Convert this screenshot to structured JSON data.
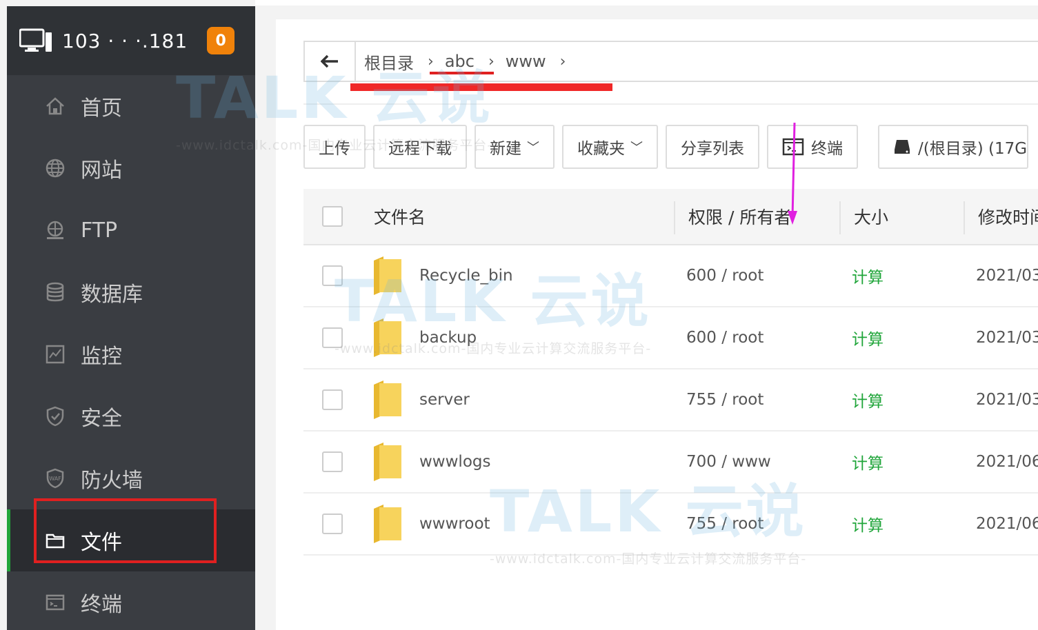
{
  "sidebar": {
    "host_ip": "103 · ·  ·.181",
    "badge": "0",
    "items": [
      {
        "label": "首页",
        "icon": "home-icon"
      },
      {
        "label": "网站",
        "icon": "globe-icon"
      },
      {
        "label": "FTP",
        "icon": "ftp-icon"
      },
      {
        "label": "数据库",
        "icon": "database-icon"
      },
      {
        "label": "监控",
        "icon": "monitor-chart-icon"
      },
      {
        "label": "安全",
        "icon": "shield-check-icon"
      },
      {
        "label": "防火墙",
        "icon": "waf-shield-icon"
      },
      {
        "label": "文件",
        "icon": "folder-icon"
      },
      {
        "label": "终端",
        "icon": "terminal-icon"
      }
    ],
    "active_item": "文件",
    "waf_icon_text": "WAF"
  },
  "breadcrumb": {
    "items": [
      "根目录",
      "abc",
      "www"
    ],
    "separator": "›"
  },
  "toolbar": {
    "upload": "上传",
    "remote_download": "远程下载",
    "new": "新建",
    "favorites": "收藏夹",
    "share_list": "分享列表",
    "terminal": "终端",
    "disk": "/(根目录) (17G"
  },
  "table": {
    "headers": {
      "name": "文件名",
      "perm": "权限 / 所有者",
      "size": "大小",
      "time": "修改时间"
    },
    "rows": [
      {
        "name": "Recycle_bin",
        "perm": "600 / root",
        "size": "计算",
        "time": "2021/03"
      },
      {
        "name": "backup",
        "perm": "600 / root",
        "size": "计算",
        "time": "2021/03"
      },
      {
        "name": "server",
        "perm": "755 / root",
        "size": "计算",
        "time": "2021/03"
      },
      {
        "name": "wwwlogs",
        "perm": "700 / www",
        "size": "计算",
        "time": "2021/06"
      },
      {
        "name": "wwwroot",
        "perm": "755 / root",
        "size": "计算",
        "time": "2021/06"
      }
    ]
  },
  "watermark": {
    "brand": "TALK 云说",
    "tagline": "-www.idctalk.com-国内专业云计算交流服务平台-"
  },
  "colors": {
    "accent": "#20a53a",
    "badge": "#f0820a",
    "annotation_red": "#e02020",
    "annotation_arrow": "#e020e0"
  }
}
